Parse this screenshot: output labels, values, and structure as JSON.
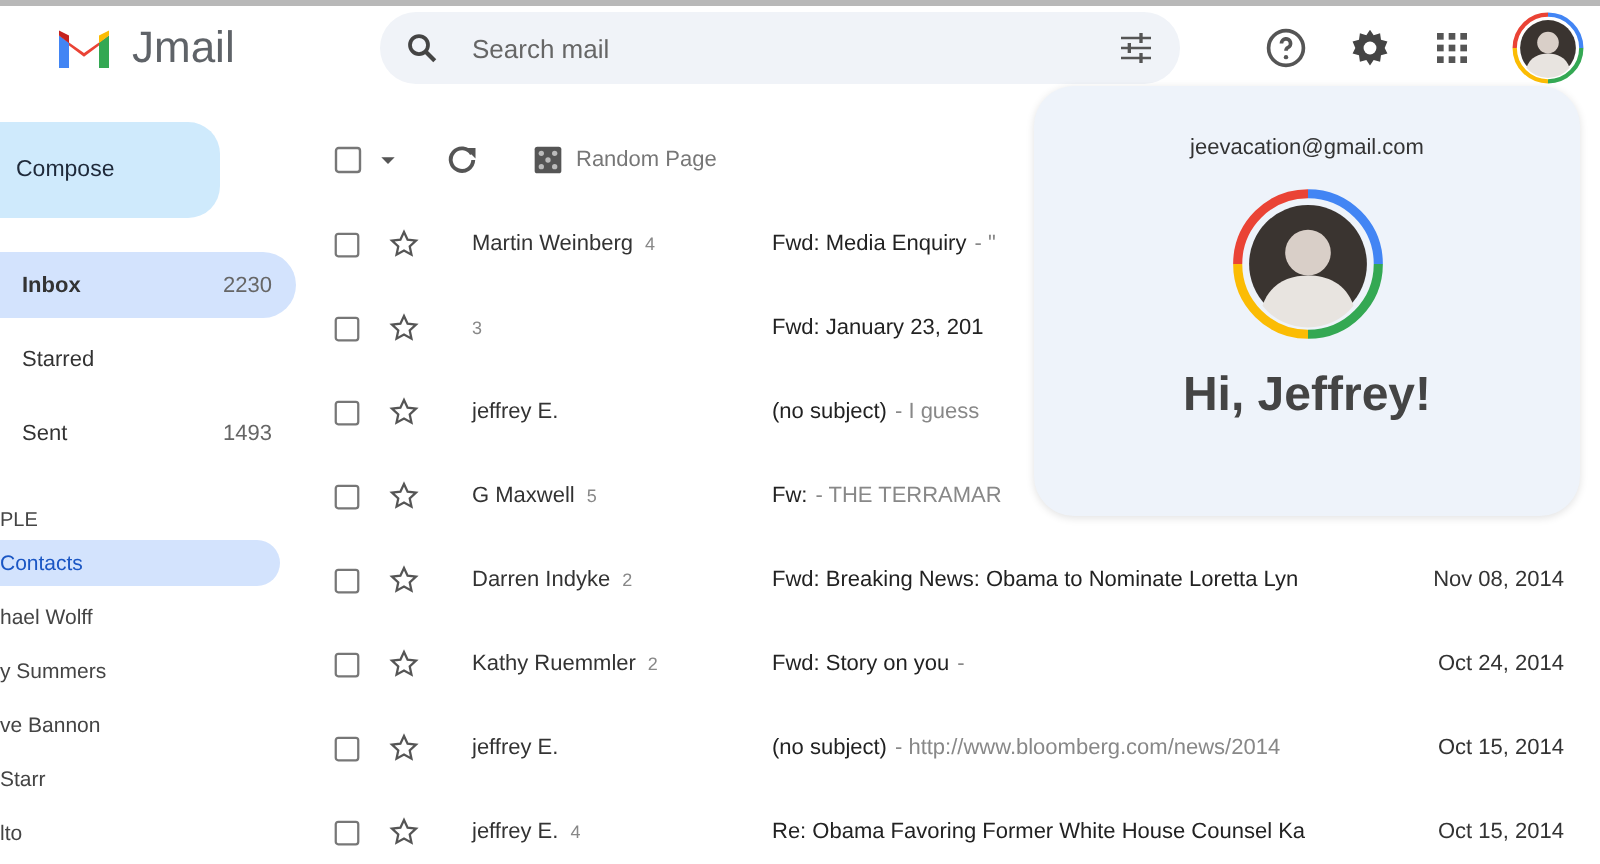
{
  "app": {
    "logo_text": "Jmail"
  },
  "search": {
    "placeholder": "Search mail"
  },
  "sidebar": {
    "compose": "Compose",
    "items": [
      {
        "label": "Inbox",
        "count": "2230",
        "selected": true
      },
      {
        "label": "Starred",
        "selected": false
      },
      {
        "label": "Sent",
        "count": "1493",
        "selected": false
      }
    ],
    "section_title": "PLE",
    "contacts": [
      {
        "label": "Contacts",
        "selected": true
      },
      {
        "label": "hael Wolff",
        "selected": false
      },
      {
        "label": "y Summers",
        "selected": false
      },
      {
        "label": "ve Bannon",
        "selected": false
      },
      {
        "label": "Starr",
        "selected": false
      },
      {
        "label": "lto",
        "selected": false
      }
    ]
  },
  "toolbar": {
    "random_label": "Random Page",
    "checked": false
  },
  "emails": [
    {
      "sender": "Martin Weinberg",
      "count": "4",
      "subject": "Fwd: Media Enquiry",
      "preview": "- \"",
      "checked": false
    },
    {
      "count": "3",
      "subject": "Fwd: January 23, 201",
      "checked": false
    },
    {
      "sender": "jeffrey E.",
      "subject": "(no subject)",
      "preview": "- I guess",
      "checked": false
    },
    {
      "sender": "G Maxwell",
      "count": "5",
      "subject": "Fw:",
      "preview": "- THE TERRAMAR",
      "checked": false
    },
    {
      "sender": "Darren Indyke",
      "count": "2",
      "subject": "Fwd: Breaking News: Obama to Nominate Loretta Lyn",
      "date": "Nov 08, 2014",
      "checked": false
    },
    {
      "sender": "Kathy Ruemmler",
      "count": "2",
      "subject": "Fwd: Story on you",
      "preview": "-",
      "date": "Oct 24, 2014",
      "checked": false
    },
    {
      "sender": "jeffrey E.",
      "subject": "(no subject)",
      "preview": "- http://www.bloomberg.com/news/2014",
      "date": "Oct 15, 2014",
      "checked": false
    },
    {
      "sender": "jeffrey E.",
      "count": "4",
      "subject": "Re: Obama Favoring Former White House Counsel Ka",
      "date": "Oct 15, 2014",
      "checked": false
    }
  ],
  "account": {
    "email": "jeevacation@gmail.com",
    "greeting": "Hi, Jeffrey!"
  }
}
